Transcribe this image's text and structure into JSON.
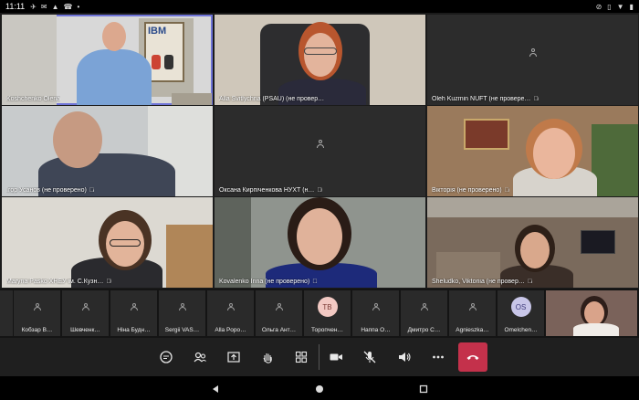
{
  "status_bar": {
    "time": "11:11",
    "left_icons": [
      "telegram-icon",
      "mail-icon",
      "warning-icon",
      "phone-icon",
      "dot-icon"
    ],
    "right_icons": [
      "do-not-disturb-icon",
      "vibrate-icon",
      "wifi-icon",
      "battery-icon"
    ]
  },
  "participants": [
    {
      "name": "Koshchenko Olena",
      "muted": false,
      "video": true,
      "active": true
    },
    {
      "name": "Alla Svitlychna (PSAU) (не провер…",
      "muted": false,
      "video": true,
      "active": false
    },
    {
      "name": "Oleh Kuzmin NUFT (не провере…",
      "muted": true,
      "video": false,
      "active": false
    },
    {
      "name": "Ігор Усанов (не проверено)",
      "muted": true,
      "video": true,
      "active": false
    },
    {
      "name": "Оксана Кирпіченкова НУХТ (н…",
      "muted": true,
      "video": false,
      "active": false
    },
    {
      "name": "Вікторія (не проверено)",
      "muted": true,
      "video": true,
      "active": false
    },
    {
      "name": "Maryna Pasko ХНЕУ ім. С.Кузн…",
      "muted": true,
      "video": true,
      "active": false
    },
    {
      "name": "Kovalenko Inna (не проверено)",
      "muted": true,
      "video": true,
      "active": false
    },
    {
      "name": "Sheludko, Viktoriia (не провер…",
      "muted": true,
      "video": true,
      "active": false
    }
  ],
  "roster": [
    {
      "name": "",
      "initials": ""
    },
    {
      "name": "Кобзар В…",
      "initials": ""
    },
    {
      "name": "Шевченк…",
      "initials": ""
    },
    {
      "name": "Ніна Будн…",
      "initials": ""
    },
    {
      "name": "Sergii VAS…",
      "initials": ""
    },
    {
      "name": "Alla Poро…",
      "initials": ""
    },
    {
      "name": "Ольга Ант…",
      "initials": ""
    },
    {
      "name": "Торопчен…",
      "initials": "TB"
    },
    {
      "name": "Наппа О…",
      "initials": ""
    },
    {
      "name": "Дмитро С…",
      "initials": ""
    },
    {
      "name": "Agnieszka…",
      "initials": ""
    },
    {
      "name": "Omelchen…",
      "initials": "OS"
    }
  ],
  "colors": {
    "accent": "#6f74d8",
    "hangup": "#c4314b",
    "tile_bg": "#2c2c2c",
    "bar_bg": "#1f1f1f",
    "avatar_tb": "#f2c9c3",
    "avatar_os": "#c8c6e8"
  },
  "controls": [
    "chat-icon",
    "people-icon",
    "share-icon",
    "raise-hand-icon",
    "layout-icon",
    "camera-icon",
    "mic-off-icon",
    "speaker-icon",
    "more-icon",
    "hang-up-icon"
  ],
  "nav": [
    "back-icon",
    "home-icon",
    "recents-icon"
  ]
}
